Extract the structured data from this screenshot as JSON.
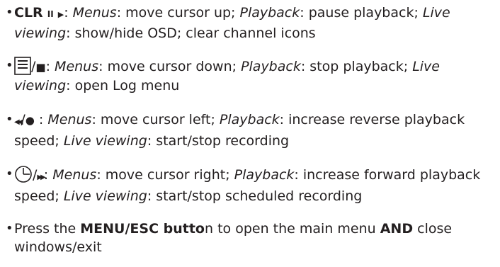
{
  "items": [
    {
      "clr": "CLR",
      "pause_glyph": "II",
      "play_glyph": "▶",
      "menus": "Menus",
      "menus_action": ": move cursor up; ",
      "playback": "Playback",
      "playback_action": ": pause playback; ",
      "live": "Live viewing",
      "live_action": ": show/hide OSD; clear channel icons"
    },
    {
      "icon": "list-icon",
      "sep": "/",
      "stop_glyph": "■",
      "menus": "Menus",
      "menus_action": ": move cursor down; ",
      "playback": "Playback",
      "playback_action": ": stop playback; ",
      "live": "Live viewing",
      "live_action": ": open Log menu"
    },
    {
      "rew_glyph": "◀◀",
      "sep": "/",
      "rec_glyph": "●",
      "colon": " : ",
      "menus": "Menus",
      "menus_action": ": move cursor left; ",
      "playback": "Playback",
      "playback_action": ": increase reverse playback speed; ",
      "live": "Live viewing",
      "live_action": ": start/stop recording"
    },
    {
      "icon": "clock-icon",
      "sep": "/",
      "ff_glyph": "▶▶",
      "colon": ": ",
      "menus": "Menus",
      "menus_action": ": move cursor right; ",
      "playback": "Playback",
      "playback_action": ": increase forward playback speed; ",
      "live": "Live viewing",
      "live_action": ": start/stop scheduled recording"
    },
    {
      "press": "Press the ",
      "button": "MENU/ESC butto",
      "n_open": "n to open the main menu ",
      "and": "AND",
      "close": " close windows/exit"
    }
  ]
}
